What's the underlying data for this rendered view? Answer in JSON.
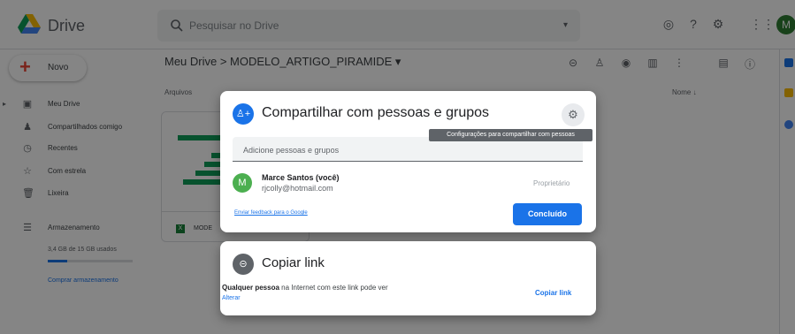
{
  "app": {
    "brand": "Drive",
    "search_placeholder": "Pesquisar no Drive",
    "avatar_initial": "M",
    "new_label": "Novo"
  },
  "sidebar": {
    "items": [
      {
        "label": "Meu Drive",
        "icon": "drive-icon"
      },
      {
        "label": "Compartilhados comigo",
        "icon": "people-icon"
      },
      {
        "label": "Recentes",
        "icon": "clock-icon"
      },
      {
        "label": "Com estrela",
        "icon": "star-icon"
      },
      {
        "label": "Lixeira",
        "icon": "trash-icon"
      }
    ],
    "storage_label": "Armazenamento",
    "storage_used": "3,4 GB de 15 GB usados",
    "storage_fraction": 0.23,
    "buy_storage": "Comprar armazenamento"
  },
  "main": {
    "breadcrumb": "Meu Drive  >  MODELO_ARTIGO_PIRAMIDE  ▾",
    "section_label": "Arquivos",
    "sort_label": "Nome  ↓",
    "file_name": "MODE"
  },
  "share_dialog": {
    "title": "Compartilhar com pessoas e grupos",
    "settings_tooltip": "Configurações para compartilhar com pessoas",
    "add_placeholder": "Adicione pessoas e grupos",
    "person": {
      "initial": "M",
      "name": "Marce Santos (você)",
      "email": "rjcolly@hotmail.com",
      "role": "Proprietário"
    },
    "feedback_link": "Enviar feedback para o Google",
    "done_label": "Concluído"
  },
  "link_dialog": {
    "title": "Copiar link",
    "description_bold": "Qualquer pessoa",
    "description_rest": " na Internet com este link pode ver",
    "change_label": "Alterar",
    "copy_label": "Copiar link"
  },
  "colors": {
    "accent": "#1a73e8",
    "avatar_green": "#4caf50"
  }
}
